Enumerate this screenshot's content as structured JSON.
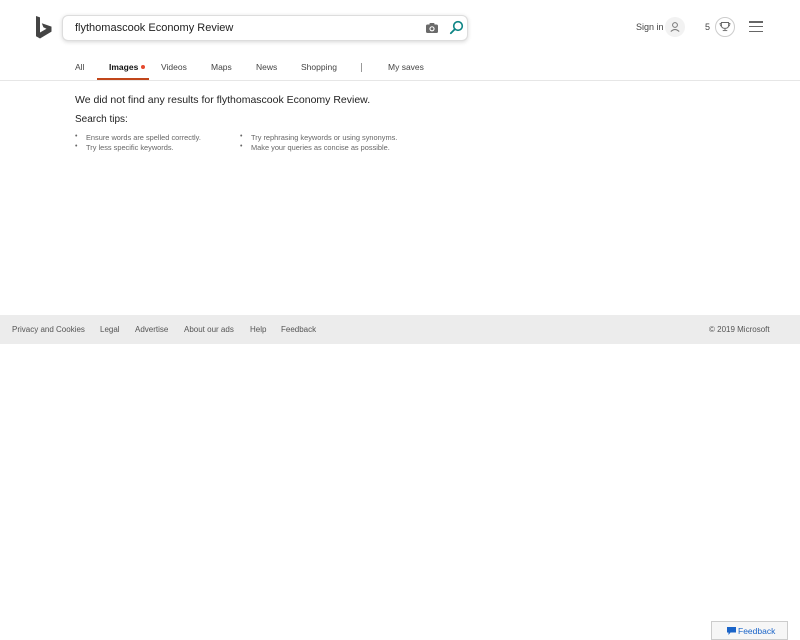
{
  "search": {
    "query": "flythomascook Economy Review"
  },
  "header": {
    "sign_in": "Sign in",
    "rewards_count": "5",
    "icons": {
      "logo": "bing-logo",
      "camera": "camera-icon",
      "search": "search-icon",
      "avatar": "user-icon",
      "rewards": "trophy-icon",
      "menu": "hamburger-menu-icon"
    }
  },
  "tabs": [
    {
      "label": "All"
    },
    {
      "label": "Images"
    },
    {
      "label": "Videos"
    },
    {
      "label": "Maps"
    },
    {
      "label": "News"
    },
    {
      "label": "Shopping"
    },
    {
      "label": "My saves"
    }
  ],
  "tab_separator": "|",
  "active_tab": "Images",
  "content": {
    "no_results": "We did not find any results for flythomascook Economy Review.",
    "tips_title": "Search tips:",
    "tips_left": [
      "Ensure words are spelled correctly.",
      "Try less specific keywords."
    ],
    "tips_right": [
      "Try rephrasing keywords or using synonyms.",
      "Make your queries as concise as possible."
    ]
  },
  "footer": {
    "links": [
      "Privacy and Cookies",
      "Legal",
      "Advertise",
      "About our ads",
      "Help",
      "Feedback"
    ],
    "copyright": "© 2019 Microsoft"
  },
  "feedback_button": {
    "label": "Feedback"
  },
  "colors": {
    "accent_underline": "#c1461a",
    "notification_dot": "#e5492e",
    "search_icon": "#0c8484",
    "feedback_blue": "#1a64c8"
  }
}
